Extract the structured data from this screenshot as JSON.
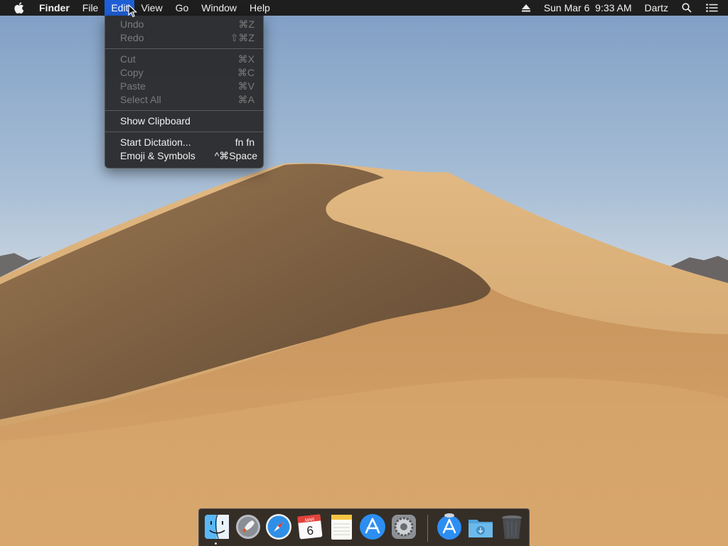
{
  "menubar": {
    "app_name": "Finder",
    "menus": [
      "File",
      "Edit",
      "View",
      "Go",
      "Window",
      "Help"
    ],
    "clock": "Sun Mar 6  9:33 AM",
    "user": "Dartz"
  },
  "edit_menu": {
    "items": [
      {
        "label": "Undo",
        "shortcut": "⌘Z",
        "enabled": false
      },
      {
        "label": "Redo",
        "shortcut": "⇧⌘Z",
        "enabled": false
      },
      {
        "label": "Cut",
        "shortcut": "⌘X",
        "enabled": false
      },
      {
        "label": "Copy",
        "shortcut": "⌘C",
        "enabled": false
      },
      {
        "label": "Paste",
        "shortcut": "⌘V",
        "enabled": false
      },
      {
        "label": "Select All",
        "shortcut": "⌘A",
        "enabled": false
      },
      {
        "label": "Show Clipboard",
        "shortcut": "",
        "enabled": true
      },
      {
        "label": "Start Dictation...",
        "shortcut": "fn fn",
        "enabled": true
      },
      {
        "label": "Emoji & Symbols",
        "shortcut": "^⌘Space",
        "enabled": true
      }
    ]
  },
  "dock": {
    "calendar_month": "MAR",
    "calendar_day": "6",
    "apps": [
      "finder-icon",
      "launchpad-icon",
      "safari-icon",
      "calendar-icon",
      "notes-icon",
      "app-store-icon",
      "system-preferences-icon",
      "app-store-download-icon",
      "downloads-folder-icon",
      "trash-icon"
    ]
  },
  "colors": {
    "menubar_bg": "#1e1e1f",
    "menu_highlight": "#1f5fd6",
    "menu_bg": "#2c2c2e",
    "disabled_text": "#7b7b7b"
  }
}
